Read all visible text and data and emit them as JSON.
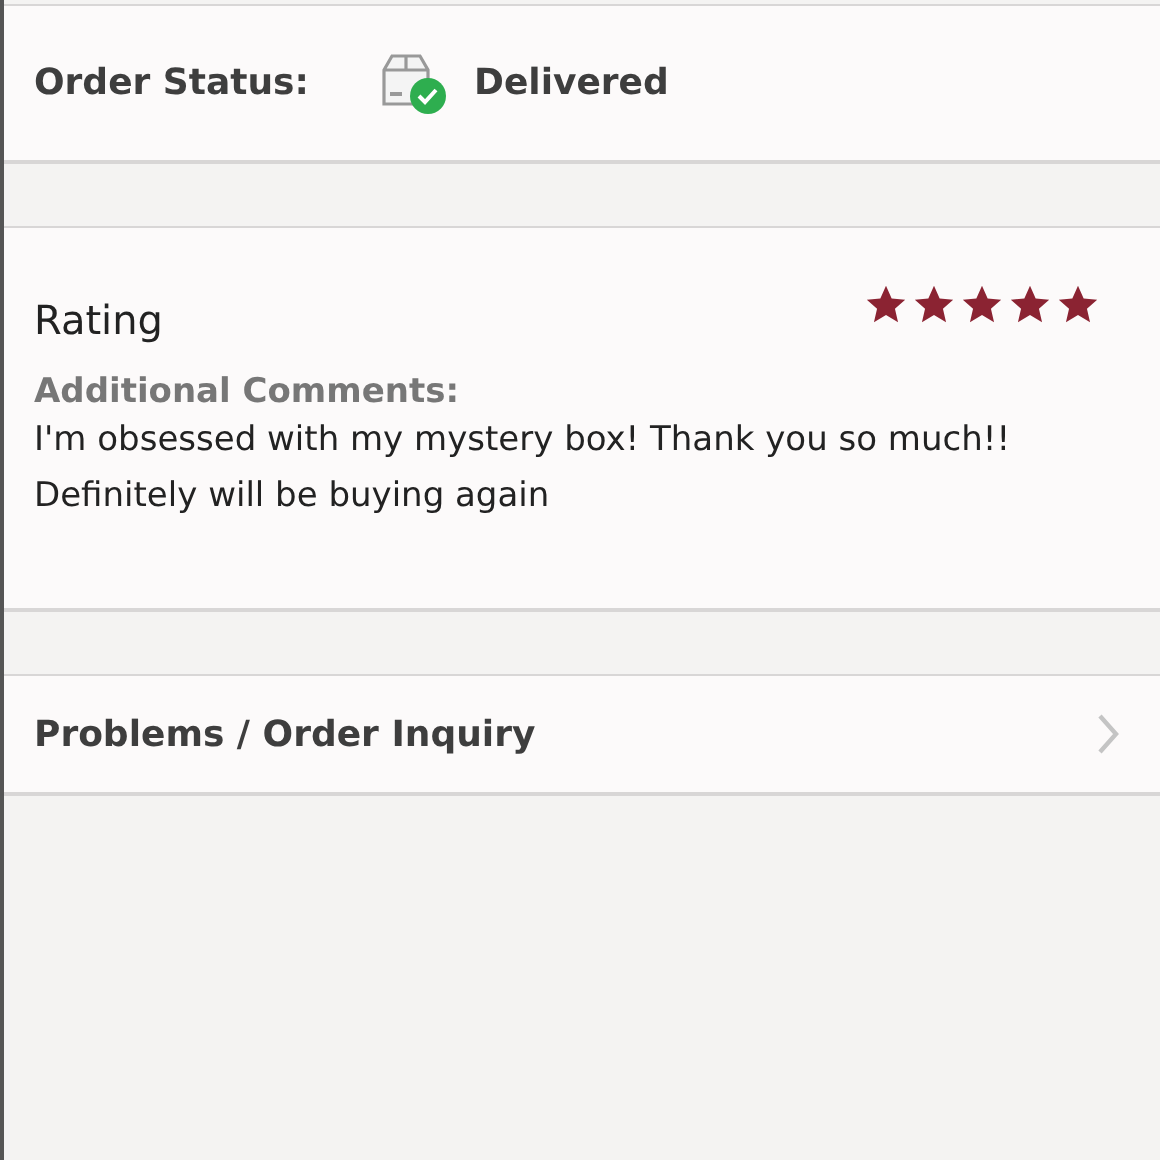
{
  "order_status": {
    "label": "Order Status:",
    "value": "Delivered"
  },
  "rating": {
    "title": "Rating",
    "stars": 5,
    "comments_label": "Additional Comments:",
    "comments": "I'm obsessed with my mystery box! Thank you so much!! Definitely will be buying again"
  },
  "inquiry": {
    "label": "Problems / Order Inquiry"
  }
}
